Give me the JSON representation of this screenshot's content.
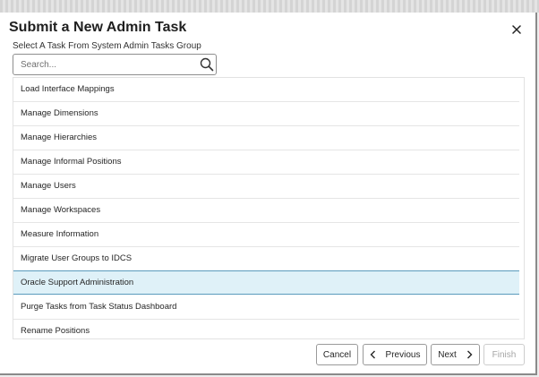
{
  "dialog": {
    "title": "Submit a New Admin Task",
    "subtitle": "Select A Task From System Admin Tasks Group"
  },
  "search": {
    "placeholder": "Search..."
  },
  "tasks": [
    "Load Interface Mappings",
    "Manage Dimensions",
    "Manage Hierarchies",
    "Manage Informal Positions",
    "Manage Users",
    "Manage Workspaces",
    "Measure Information",
    "Migrate User Groups to IDCS",
    "Oracle Support Administration",
    "Purge Tasks from Task Status Dashboard",
    "Rename Positions"
  ],
  "selected_task": "Oracle Support Administration",
  "buttons": {
    "cancel": "Cancel",
    "previous": "Previous",
    "next": "Next",
    "finish": "Finish"
  },
  "colors": {
    "selected_bg": "#dff1f8",
    "selected_border": "#5a9bbc"
  },
  "icons": [
    "close-icon",
    "search-icon",
    "chevron-left-icon",
    "chevron-right-icon"
  ]
}
